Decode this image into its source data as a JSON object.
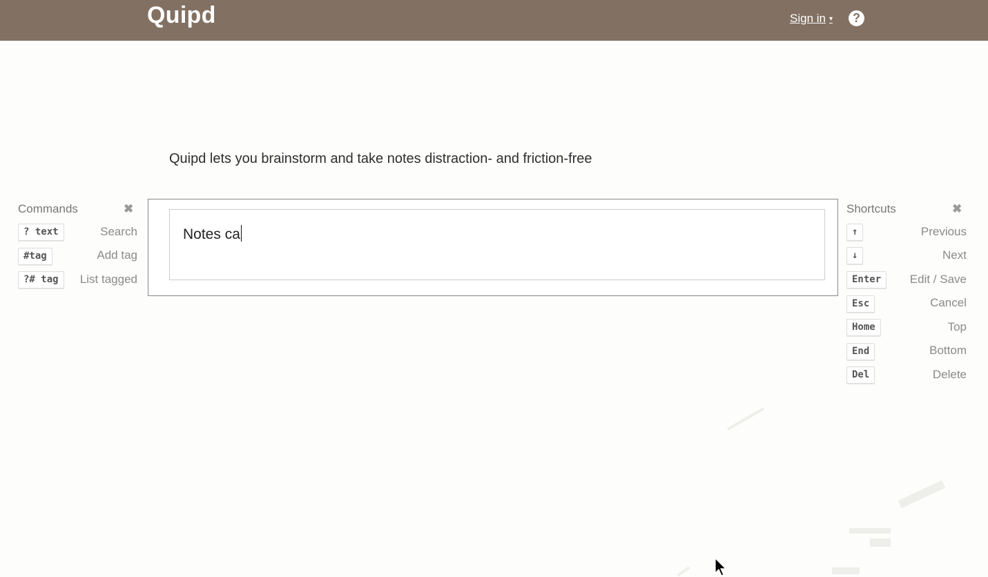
{
  "header": {
    "logo": "Quipd",
    "signin_label": "Sign in",
    "signin_caret": "▾",
    "help_icon": "?"
  },
  "tagline": "Quipd lets you brainstorm and take notes distraction- and friction-free",
  "editor": {
    "value": "Notes ca"
  },
  "commands": {
    "title": "Commands",
    "close_icon": "✖",
    "items": [
      {
        "key": "? text",
        "label": "Search"
      },
      {
        "key": "#tag",
        "label": "Add tag"
      },
      {
        "key": "?# tag",
        "label": "List tagged"
      }
    ]
  },
  "shortcuts": {
    "title": "Shortcuts",
    "close_icon": "✖",
    "items": [
      {
        "key": "↑",
        "label": "Previous"
      },
      {
        "key": "↓",
        "label": "Next"
      },
      {
        "key": "Enter",
        "label": "Edit / Save"
      },
      {
        "key": "Esc",
        "label": "Cancel"
      },
      {
        "key": "Home",
        "label": "Top"
      },
      {
        "key": "End",
        "label": "Bottom"
      },
      {
        "key": "Del",
        "label": "Delete"
      }
    ]
  },
  "colors": {
    "header_bg": "#827163",
    "page_bg": "#fdfdfc"
  }
}
